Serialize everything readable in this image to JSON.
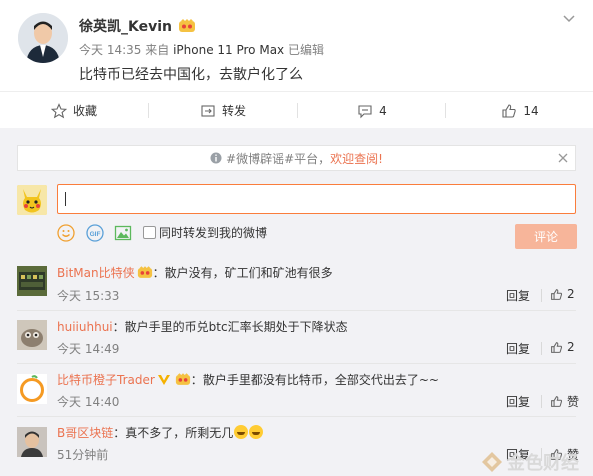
{
  "post": {
    "author": "徐英凯_Kevin",
    "time": "今天 14:35",
    "source_prefix": "来自",
    "source": "iPhone 11 Pro Max",
    "edited": "已编辑",
    "text": "比特币已经去中国化，去散户化了么"
  },
  "actions": {
    "favorite": "收藏",
    "repost": "转发",
    "comment_count": "4",
    "like_count": "14"
  },
  "notice": {
    "text": "#微博辟谣#平台，",
    "link": "欢迎查阅!"
  },
  "composer": {
    "input_value": "",
    "sync_label": "同时转发到我的微博",
    "submit": "评论"
  },
  "comments": [
    {
      "user": "BitMan比特侠",
      "sep": "：",
      "text": "散户没有，矿工们和矿池有很多",
      "time": "今天 15:33",
      "reply": "回复",
      "likes": "2"
    },
    {
      "user": "huiiuhhui",
      "sep": "：",
      "text": "散户手里的币兑btc汇率长期处于下降状态",
      "time": "今天 14:49",
      "reply": "回复",
      "likes": "2"
    },
    {
      "user": "比特币橙子Trader",
      "sep": "：",
      "text": "散户手里都没有比特币，全部交代出去了~~",
      "time": "今天 14:40",
      "reply": "回复",
      "likes": "赞"
    },
    {
      "user": "B哥区块链",
      "sep": "：",
      "text": "真不多了，所剩无几",
      "time": "51分钟前",
      "reply": "回复",
      "likes": "赞"
    }
  ],
  "watermark": "金色财经",
  "colors": {
    "accent": "#eb7350",
    "submit_disabled": "#f7b59a",
    "background": "#f2f2f5"
  }
}
